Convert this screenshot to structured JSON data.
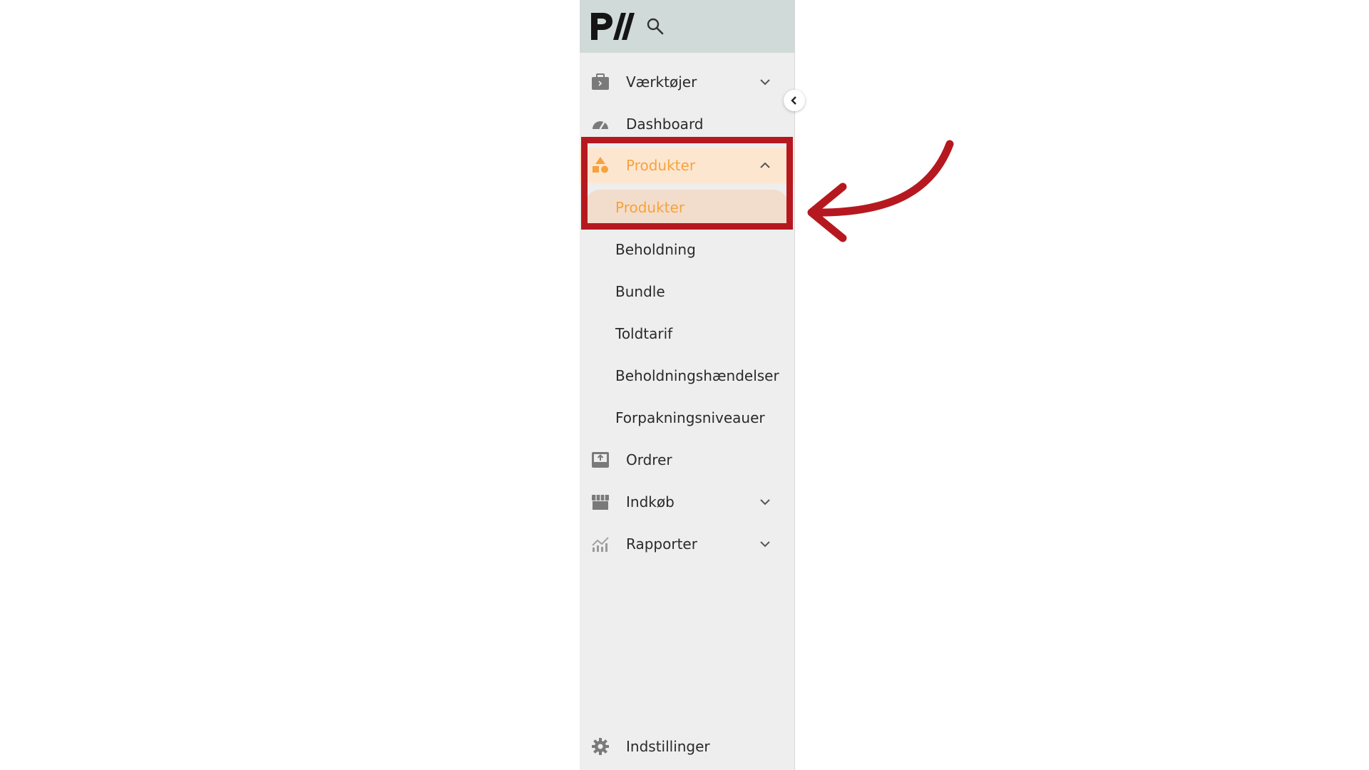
{
  "sidebar": {
    "logo_text": "PW",
    "items": [
      {
        "label": "Værktøjer",
        "icon": "toolbox-icon",
        "has_chevron": true
      },
      {
        "label": "Dashboard",
        "icon": "gauge-icon",
        "has_chevron": false
      },
      {
        "label": "Produkter",
        "icon": "shapes-icon",
        "has_chevron": true,
        "expanded": true,
        "active": true
      },
      {
        "label": "Ordrer",
        "icon": "tray-upload-icon",
        "has_chevron": false
      },
      {
        "label": "Indkøb",
        "icon": "store-icon",
        "has_chevron": true
      },
      {
        "label": "Rapporter",
        "icon": "chart-icon",
        "has_chevron": true
      }
    ],
    "sub_items": [
      {
        "label": "Produkter",
        "selected": true
      },
      {
        "label": "Beholdning"
      },
      {
        "label": "Bundle"
      },
      {
        "label": "Toldtarif"
      },
      {
        "label": "Beholdningshændelser"
      },
      {
        "label": "Forpakningsniveauer"
      }
    ],
    "footer": {
      "label": "Indstillinger",
      "icon": "gear-icon"
    }
  },
  "colors": {
    "accent": "#f7a23b",
    "active_bg": "#fde6d0",
    "annotation": "#b5191f",
    "sidebar_bg": "#eeeeee",
    "header_bg": "#d0dad8"
  }
}
